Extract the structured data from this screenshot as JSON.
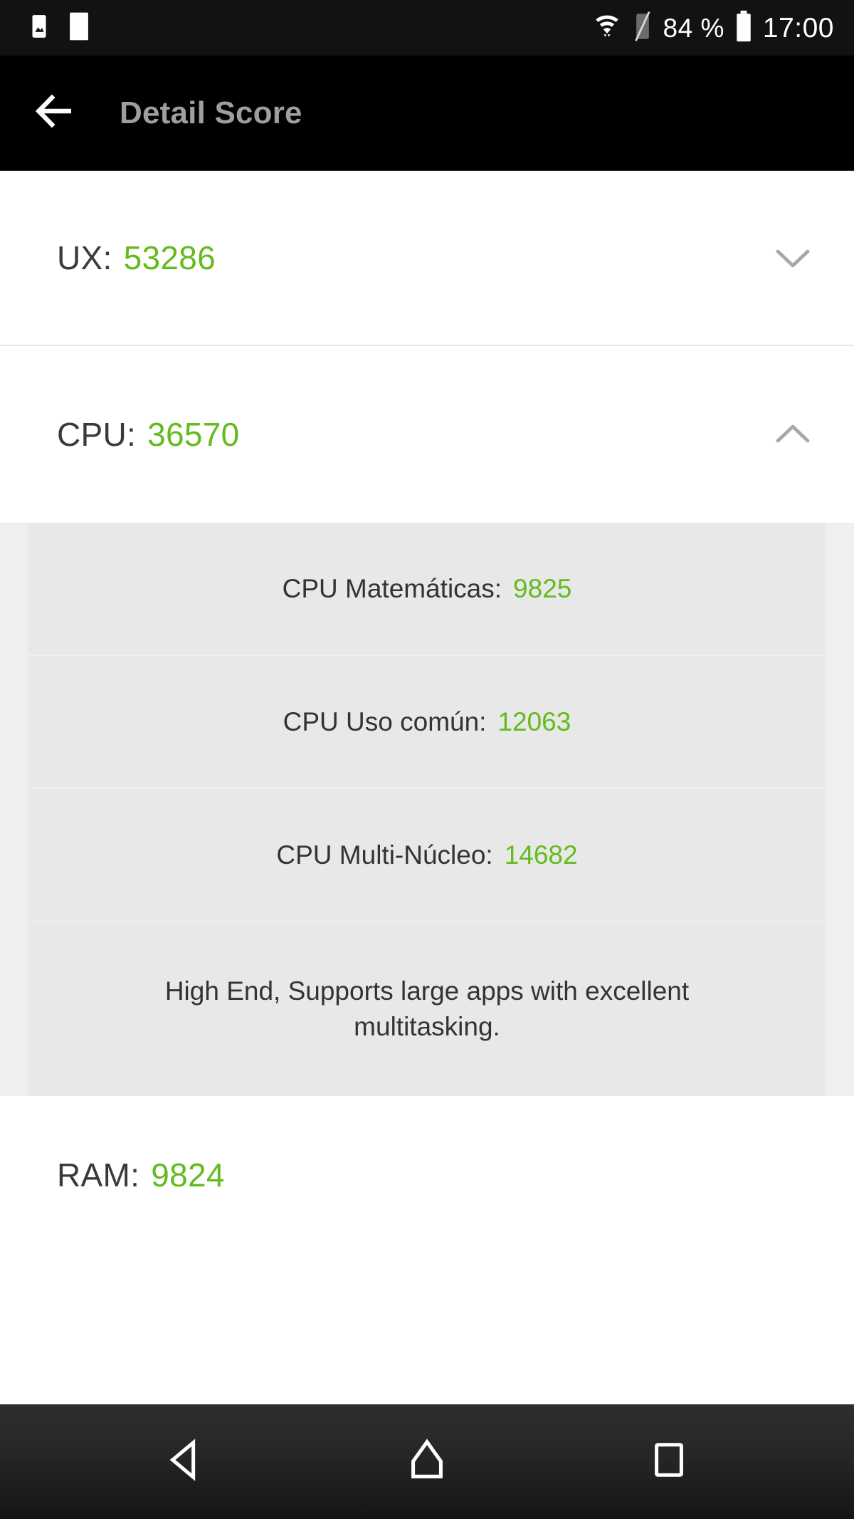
{
  "status_bar": {
    "icons": [
      "image-icon",
      "blank-notification-icon"
    ],
    "wifi_icon": "wifi-icon",
    "signal_icon": "signal-off-icon",
    "battery_percent": "84 %",
    "battery_icon": "battery-icon",
    "clock": "17:00"
  },
  "app_bar": {
    "back_icon": "back-arrow-icon",
    "title": "Detail Score"
  },
  "theme": {
    "accent_green": "#63bb1d",
    "label_gray": "#3a3a3a",
    "app_bar_bg": "#000000",
    "card_bg": "#e8e8e8",
    "card_gutter_bg": "#efefef"
  },
  "sections": [
    {
      "id": "ux",
      "label": "UX:",
      "value": "53286",
      "expanded": false,
      "chevron_icon": "chevron-down-icon"
    },
    {
      "id": "cpu",
      "label": "CPU:",
      "value": "36570",
      "expanded": true,
      "chevron_icon": "chevron-up-icon",
      "sub_items": [
        {
          "label": "CPU Matemáticas:",
          "value": "9825"
        },
        {
          "label": "CPU Uso común:",
          "value": "12063"
        },
        {
          "label": "CPU Multi-Núcleo:",
          "value": "14682"
        }
      ],
      "description": "High End, Supports large apps with excellent multitasking."
    },
    {
      "id": "ram",
      "label": "RAM:",
      "value": "9824",
      "expanded": false,
      "chevron_icon": ""
    }
  ],
  "nav_bar": {
    "back": "nav-back-icon",
    "home": "nav-home-icon",
    "recents": "nav-recents-icon"
  }
}
